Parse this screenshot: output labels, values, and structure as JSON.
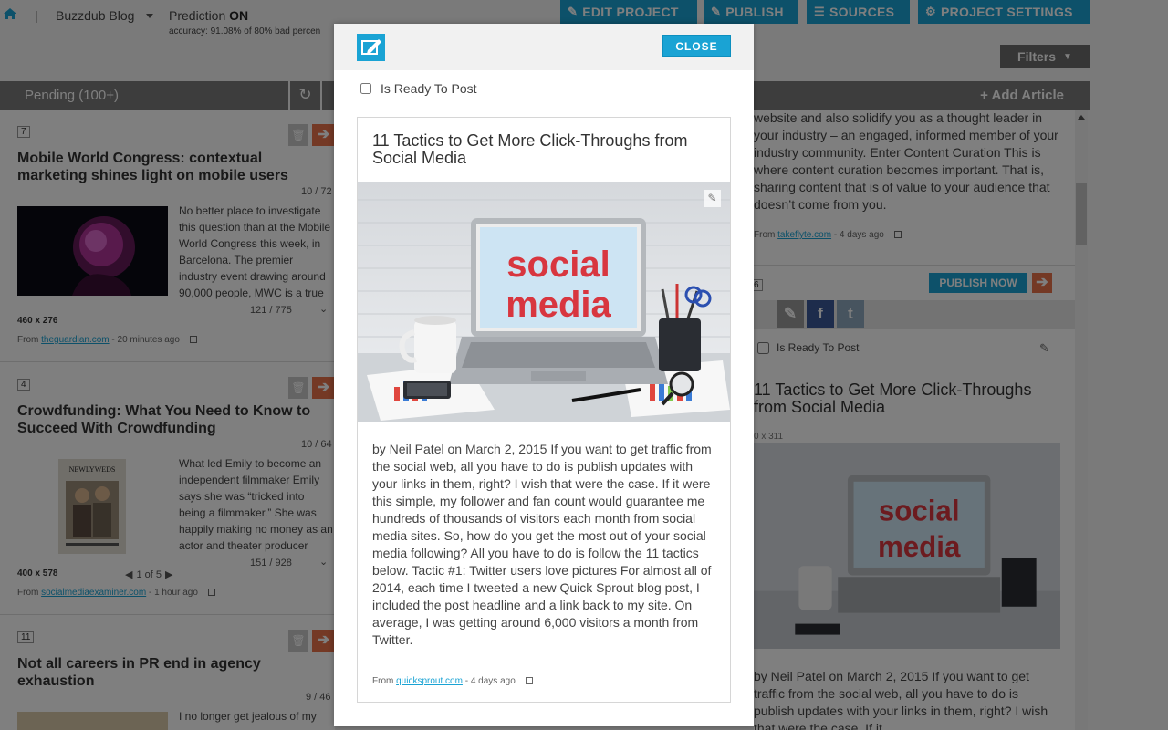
{
  "header": {
    "blog_name": "Buzzdub Blog",
    "prediction_label": "Prediction",
    "prediction_state": "ON",
    "accuracy_text": "accuracy: 91.08% of 80%   bad percen",
    "buttons": {
      "edit_project": "EDIT PROJECT",
      "publish": "PUBLISH",
      "sources": "SOURCES",
      "project_settings": "PROJECT SETTINGS"
    },
    "filters_label": "Filters"
  },
  "columns": {
    "pending_label": "Pending (100+)",
    "add_article_label": "+ Add Article"
  },
  "pending_cards": [
    {
      "badge": "7",
      "title": "Mobile World Congress: contextual marketing shines light on mobile users",
      "page_count": "10 / 72",
      "excerpt": "No better place to investigate this question than at the Mobile World Congress this week, in Barcelona. The premier industry event drawing around 90,000 people, MWC is a true",
      "excerpt_count": "121 / 775",
      "image_size": "460 x 276",
      "source": "theguardian.com",
      "time": "- 20 minutes ago",
      "from_label": "From"
    },
    {
      "badge": "4",
      "title": "Crowdfunding: What You Need to Know to Succeed With Crowdfunding",
      "page_count": "10 / 64",
      "excerpt": "What led Emily to become an independent filmmaker Emily says she was “tricked into being a filmmaker.” She was happily making no money as an actor and theater producer",
      "excerpt_count": "151 / 928",
      "image_size": "400 x 578",
      "image_pager": "1 of 5",
      "poster_title": "NEWLYWEDS",
      "source": "socialmediaexaminer.com",
      "time": "- 1 hour ago",
      "from_label": "From"
    },
    {
      "badge": "11",
      "title": "Not all careers in PR end in agency exhaustion",
      "page_count": "9 / 46",
      "excerpt": "I no longer get jealous of my"
    }
  ],
  "right_column": {
    "top_text": "website and also solidify you as a thought leader in your industry – an engaged, informed member of your industry community. Enter Content Curation This is where content curation becomes important. That is, sharing content that is of value to your audience that doesn’t come from you.",
    "top_source": "takeflyte.com",
    "top_time": "- 4 days ago",
    "publish_now": "PUBLISH NOW",
    "badge_fragment": "6",
    "ready_label": "Is Ready To Post",
    "title": "11 Tactics to Get More Click-Throughs from Social Media",
    "image_size": "0 x 311",
    "body": "by Neil Patel on March 2, 2015 If you want to get traffic from the social web, all you have to do is publish updates with your links in them, right? I wish that were the case. If it"
  },
  "modal": {
    "close_label": "CLOSE",
    "ready_label": "Is Ready To Post",
    "title": "11 Tactics to Get More Click-Throughs from Social Media",
    "body": "by Neil Patel on March 2, 2015 If you want to get traffic from the social web, all you have to do is publish updates with your links in them, right? I wish that were the case. If it were this simple, my follower and fan count would guarantee me hundreds of thousands of visitors each month from social media sites. So, how do you get the most out of your social media following? All you have to do is follow the 11 tactics below. Tactic #1: Twitter users love pictures For almost all of 2014, each time I tweeted a new Quick Sprout blog post, I included the post headline and a link back to my site. On average, I was getting around 6,000 visitors a month from Twitter.",
    "from_label": "From",
    "source": "quicksprout.com",
    "time": "- 4 days ago",
    "image_text_line1": "social",
    "image_text_line2": "media"
  },
  "colors": {
    "accent": "#1aa3d4",
    "orange": "#e8734a",
    "bar_gray": "#7b7b7b",
    "facebook": "#3b5998",
    "twitter": "#55acee"
  }
}
